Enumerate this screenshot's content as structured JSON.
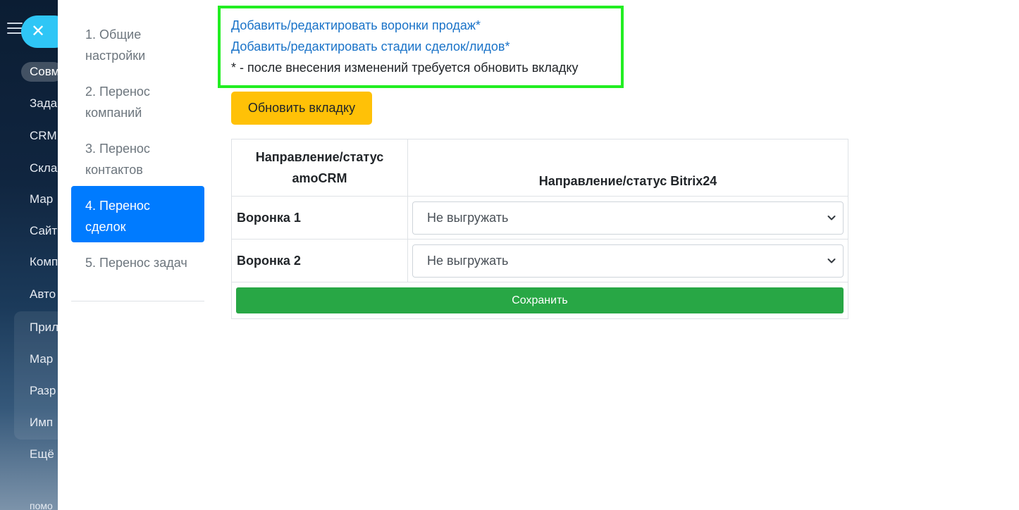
{
  "background": {
    "close_icon_glyph": "✕",
    "items": [
      "Совм",
      "Зада",
      "CRM",
      "Скла",
      "Мар",
      "Сайт",
      "Комп",
      "Авто",
      "Прил",
      "Мар",
      "Разр",
      "Имп",
      "Ещё",
      "помо"
    ]
  },
  "nav": {
    "items": [
      {
        "label": "1. Общие настройки"
      },
      {
        "label": "2. Перенос компаний"
      },
      {
        "label": "3. Перенос контактов"
      },
      {
        "label": "4. Перенос сделок"
      },
      {
        "label": "5. Перенос задач"
      }
    ],
    "active_index": 3
  },
  "links": {
    "funnels": "Добавить/редактировать воронки продаж*",
    "stages": "Добавить/редактировать стадии сделок/лидов*",
    "note": "* - после внесения изменений требуется обновить вкладку"
  },
  "refresh_button": "Обновить вкладку",
  "table": {
    "headers": [
      "Направление/статус amoCRM",
      "Направление/статус Bitrix24"
    ],
    "rows": [
      {
        "label": "Воронка 1",
        "selected": "Не выгружать"
      },
      {
        "label": "Воронка 2",
        "selected": "Не выгружать"
      }
    ],
    "save_label": "Сохранить"
  },
  "colors": {
    "active_tab": "#007bff",
    "highlight_border": "#22ee22",
    "refresh_button": "#ffc107",
    "save_button": "#28a745",
    "link": "#1a73c8"
  }
}
